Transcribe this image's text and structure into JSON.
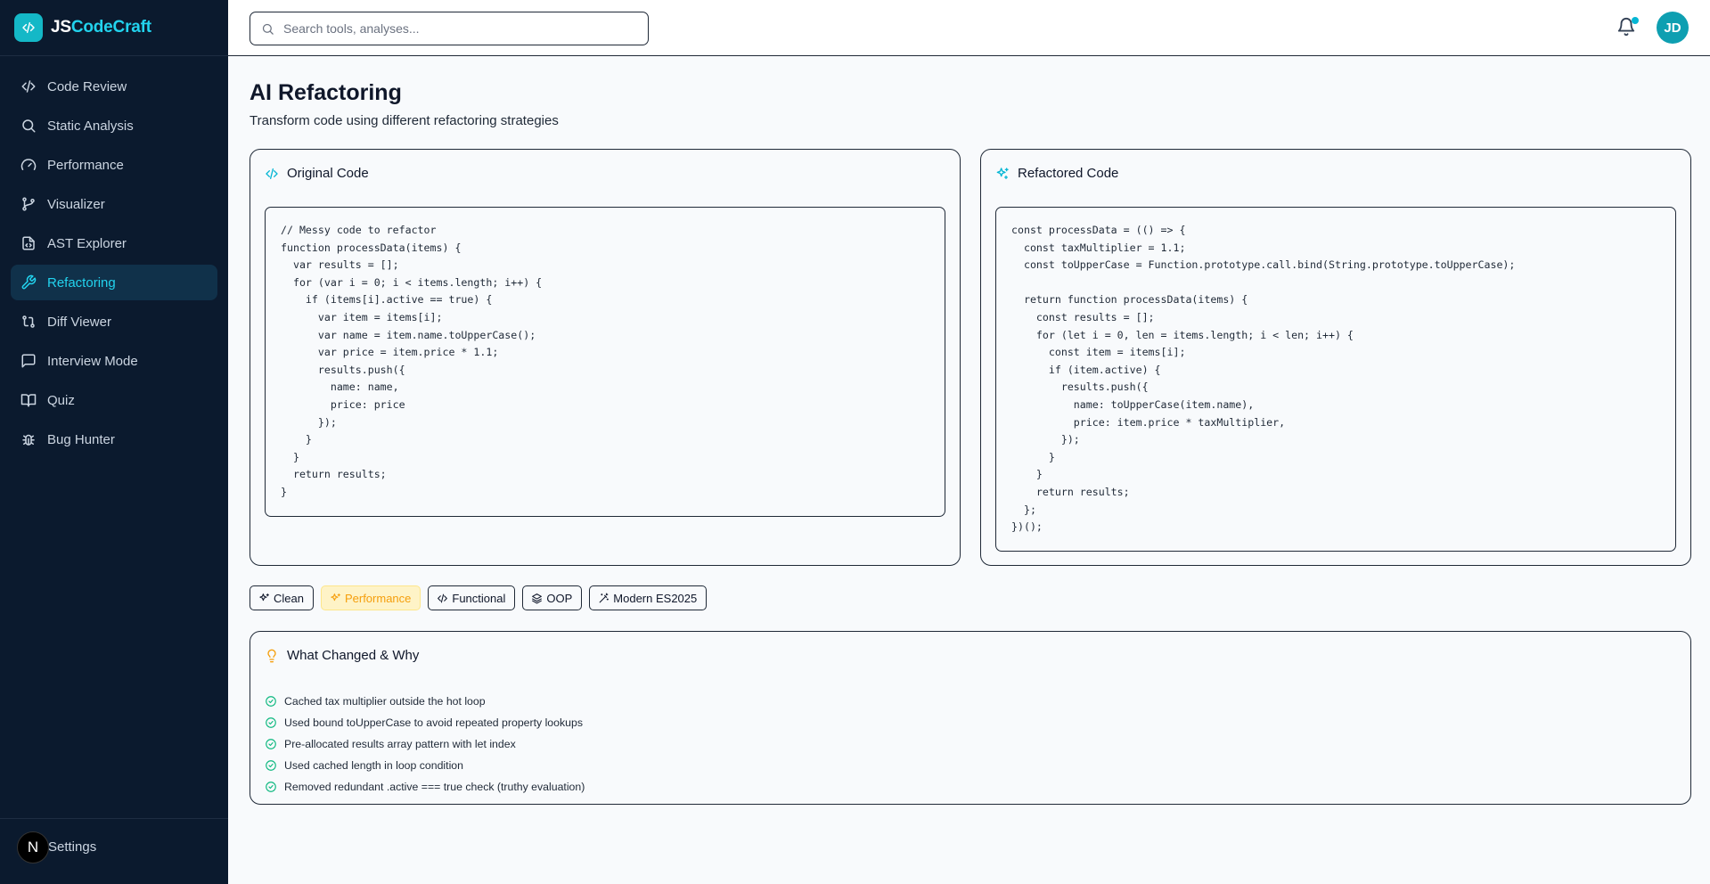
{
  "brand": {
    "prefix": "JS",
    "suffix": "CodeCraft"
  },
  "sidebar": {
    "items": [
      {
        "label": "Code Review",
        "icon": "code-icon"
      },
      {
        "label": "Static Analysis",
        "icon": "search-icon"
      },
      {
        "label": "Performance",
        "icon": "gauge-icon"
      },
      {
        "label": "Visualizer",
        "icon": "git-branch-icon"
      },
      {
        "label": "AST Explorer",
        "icon": "file-code-icon"
      },
      {
        "label": "Refactoring",
        "icon": "wrench-icon",
        "active": true
      },
      {
        "label": "Diff Viewer",
        "icon": "git-compare-icon"
      },
      {
        "label": "Interview Mode",
        "icon": "message-square-icon"
      },
      {
        "label": "Quiz",
        "icon": "book-open-icon"
      },
      {
        "label": "Bug Hunter",
        "icon": "bug-icon"
      }
    ],
    "footer": {
      "badge": "N",
      "settings_label": "Settings"
    }
  },
  "topbar": {
    "search_placeholder": "Search tools, analyses...",
    "avatar_initials": "JD"
  },
  "page": {
    "title": "AI Refactoring",
    "subtitle": "Transform code using different refactoring strategies"
  },
  "original": {
    "title": "Original Code",
    "code": "// Messy code to refactor\nfunction processData(items) {\n  var results = [];\n  for (var i = 0; i < items.length; i++) {\n    if (items[i].active == true) {\n      var item = items[i];\n      var name = item.name.toUpperCase();\n      var price = item.price * 1.1;\n      results.push({\n        name: name,\n        price: price\n      });\n    }\n  }\n  return results;\n}"
  },
  "refactored": {
    "title": "Refactored Code",
    "code": "const processData = (() => {\n  const taxMultiplier = 1.1;\n  const toUpperCase = Function.prototype.call.bind(String.prototype.toUpperCase);\n\n  return function processData(items) {\n    const results = [];\n    for (let i = 0, len = items.length; i < len; i++) {\n      const item = items[i];\n      if (item.active) {\n        results.push({\n          name: toUpperCase(item.name),\n          price: item.price * taxMultiplier,\n        });\n      }\n    }\n    return results;\n  };\n})();"
  },
  "strategies": [
    {
      "label": "Clean",
      "icon": "sparkles-icon"
    },
    {
      "label": "Performance",
      "icon": "zap-icon",
      "active": true
    },
    {
      "label": "Functional",
      "icon": "code-icon"
    },
    {
      "label": "OOP",
      "icon": "layers-icon"
    },
    {
      "label": "Modern ES2025",
      "icon": "wand-icon"
    }
  ],
  "changes": {
    "title": "What Changed & Why",
    "items": [
      "Cached tax multiplier outside the hot loop",
      "Used bound toUpperCase to avoid repeated property lookups",
      "Pre-allocated results array pattern with let index",
      "Used cached length in loop condition",
      "Removed redundant .active === true check (truthy evaluation)"
    ]
  },
  "colors": {
    "sidebar_bg": "#0b1a2e",
    "accent": "#22d3ee",
    "active_chip": "#f59e0b",
    "check_green": "#10b981",
    "bulb_amber": "#f59e0b"
  }
}
